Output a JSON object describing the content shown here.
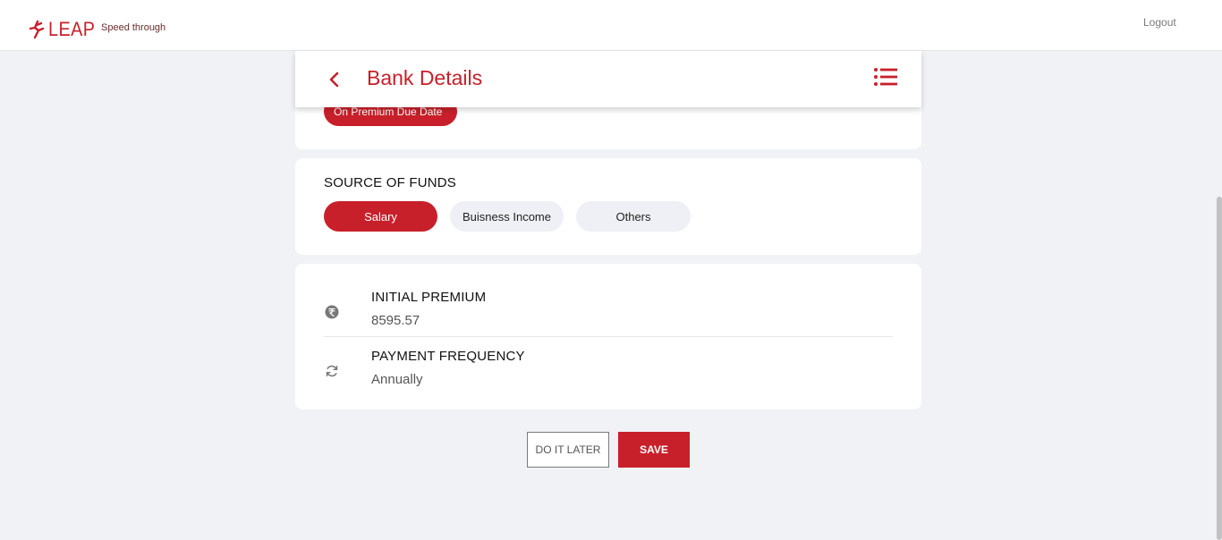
{
  "brand": {
    "logo_text": "LEAP",
    "tagline": "Speed through",
    "accent_color": "#c8202a"
  },
  "topbar": {
    "logout_label": "Logout"
  },
  "header": {
    "title": "Bank Details",
    "back_icon": "chevron-left-icon",
    "menu_icon": "list-menu-icon"
  },
  "previous_section": {
    "chip_label": "On Premium Due Date"
  },
  "source_of_funds": {
    "title": "SOURCE OF FUNDS",
    "options": [
      {
        "label": "Salary",
        "selected": true
      },
      {
        "label": "Buisness Income",
        "selected": false
      },
      {
        "label": "Others",
        "selected": false
      }
    ]
  },
  "summary": {
    "rows": [
      {
        "icon": "rupee-icon",
        "label": "INITIAL PREMIUM",
        "value": "8595.57"
      },
      {
        "icon": "refresh-icon",
        "label": "PAYMENT FREQUENCY",
        "value": "Annually"
      }
    ]
  },
  "actions": {
    "later_label": "DO IT LATER",
    "save_label": "SAVE"
  }
}
